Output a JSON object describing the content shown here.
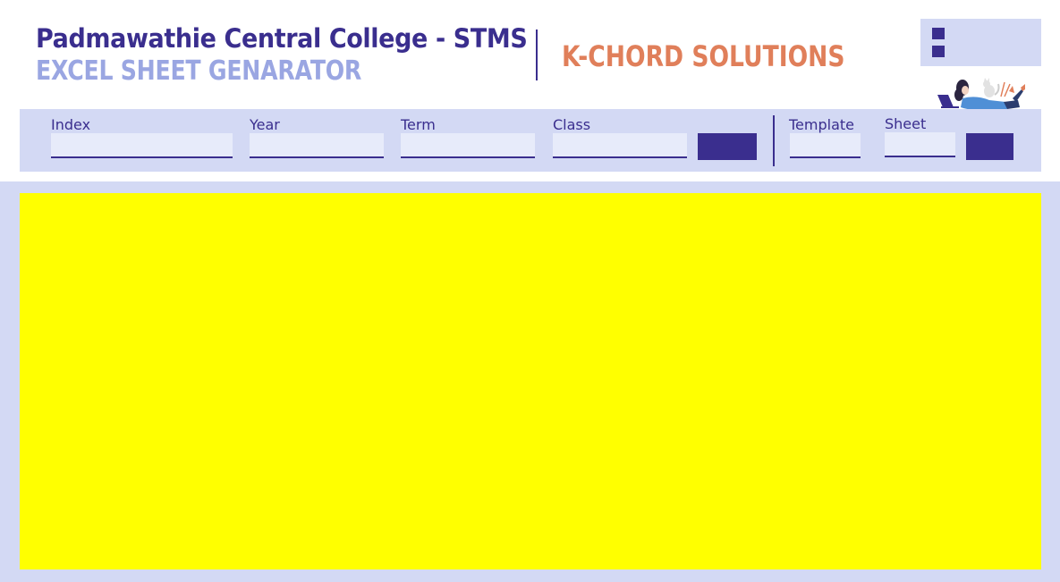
{
  "header": {
    "title": "Padmawathie Central College - STMS",
    "subtitle": "EXCEL SHEET GENARATOR",
    "brand": "K-CHORD SOLUTIONS"
  },
  "toolbar": {
    "fields": {
      "index": {
        "label": "Index",
        "value": ""
      },
      "year": {
        "label": "Year",
        "value": ""
      },
      "term": {
        "label": "Term",
        "value": ""
      },
      "class": {
        "label": "Class",
        "value": ""
      },
      "template": {
        "label": "Template",
        "value": ""
      },
      "sheet": {
        "label": "Sheet",
        "value": ""
      }
    },
    "primary_button_label": "",
    "secondary_button_label": ""
  },
  "icons": {
    "menu": "menu-squares-icon",
    "illustration": "woman-with-laptop-and-cat-illustration"
  },
  "colors": {
    "primary": "#3a2e8e",
    "accent_light": "#9aa6e2",
    "brand": "#e07f5a",
    "panel": "#d3d9f4",
    "input": "#e7ebfa",
    "canvas": "#ffff00"
  }
}
